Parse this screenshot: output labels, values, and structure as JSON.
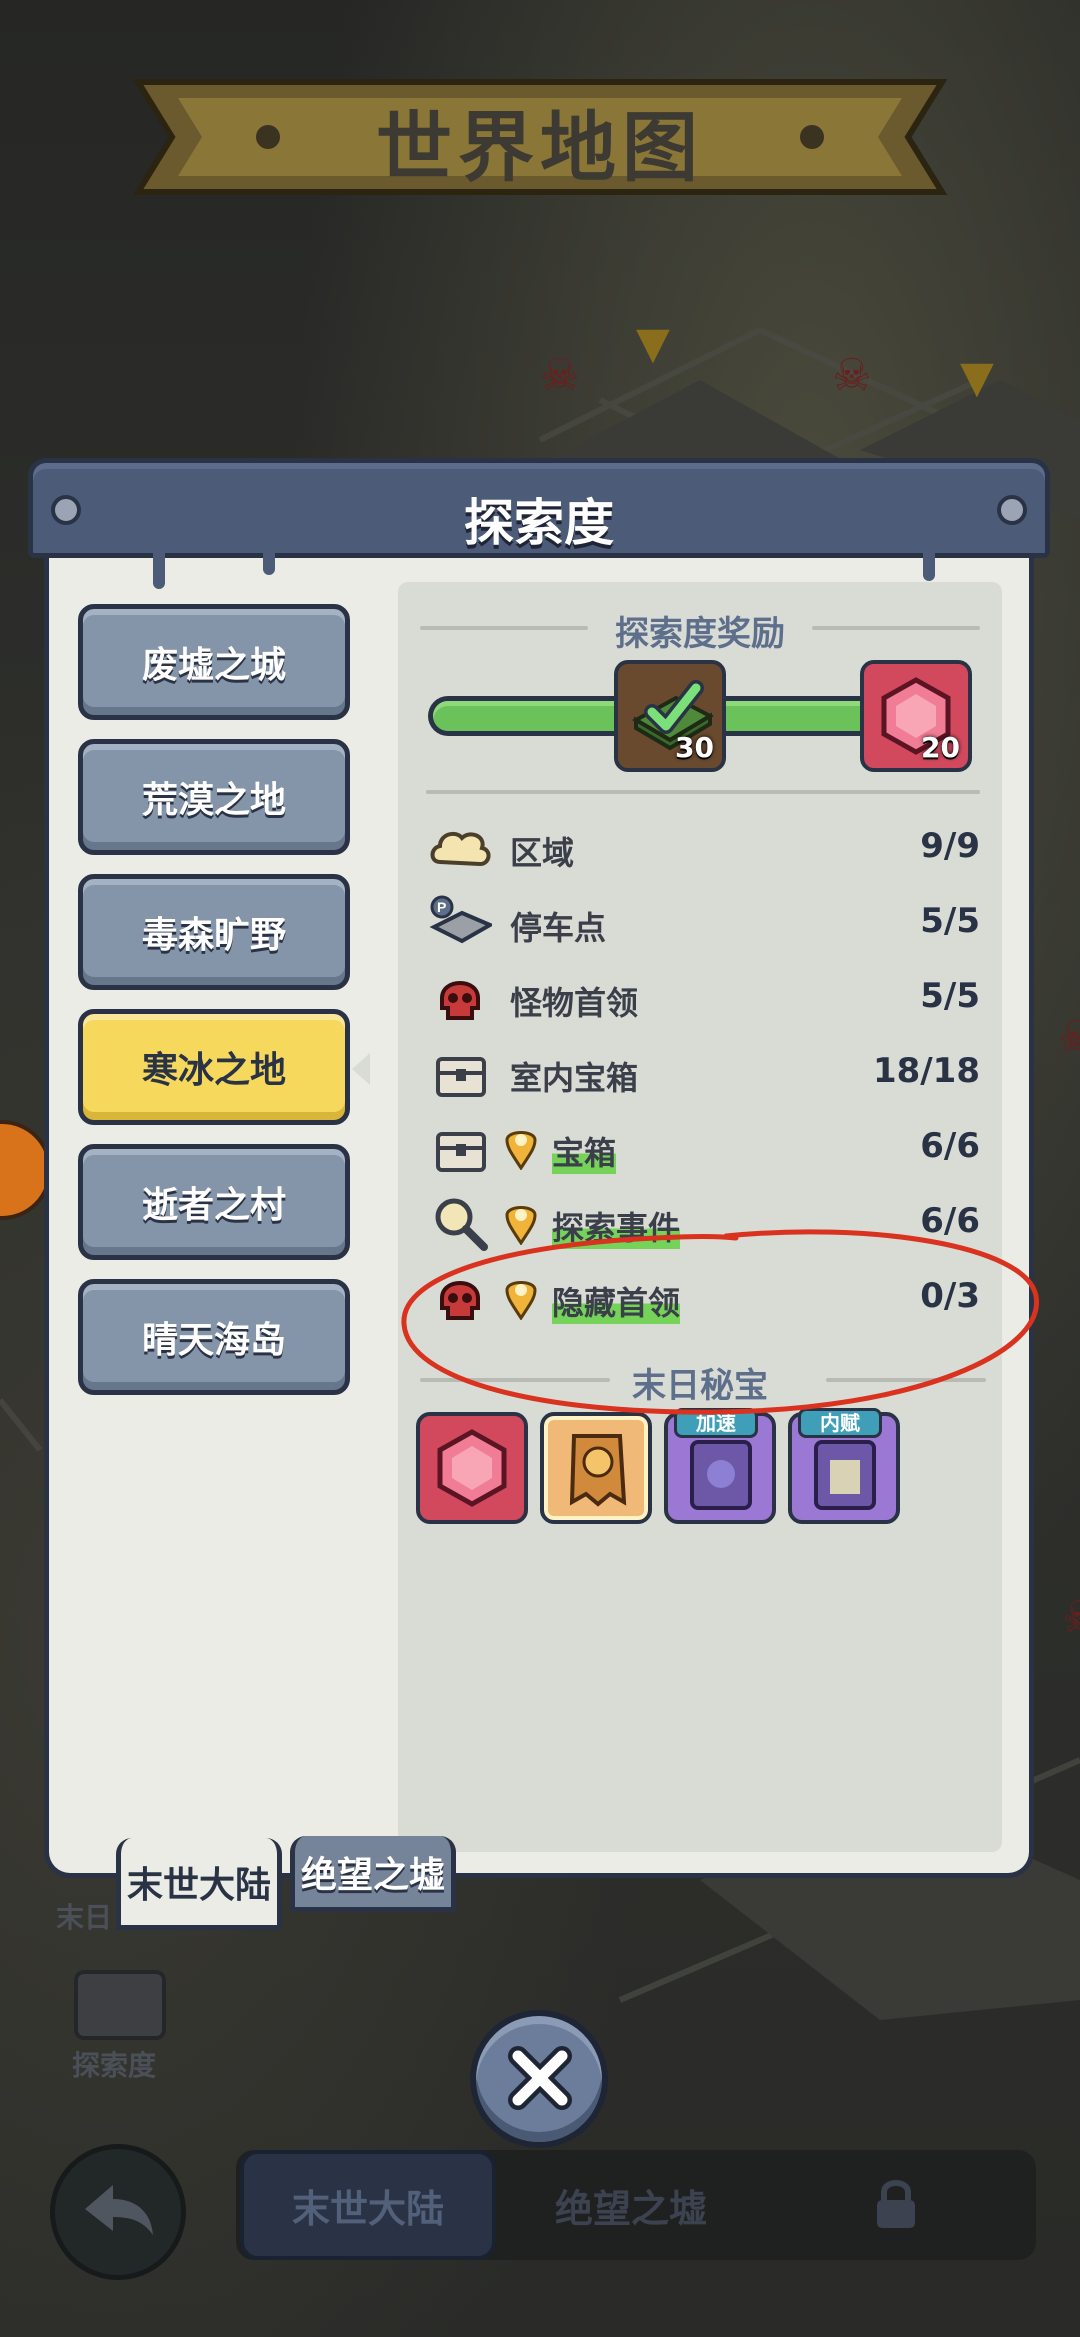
{
  "background": {
    "map_title": "世界地图",
    "labels": {
      "end_prefix": "末日",
      "exploration": "探索度"
    }
  },
  "panel": {
    "title": "探索度",
    "regions": [
      {
        "label": "废墟之城",
        "active": false
      },
      {
        "label": "荒漠之地",
        "active": false
      },
      {
        "label": "毒森旷野",
        "active": false
      },
      {
        "label": "寒冰之地",
        "active": true
      },
      {
        "label": "逝者之村",
        "active": false
      },
      {
        "label": "晴天海岛",
        "active": false
      }
    ],
    "reward_section": {
      "title": "探索度奖励",
      "progress": 1.0,
      "rewards": [
        {
          "icon": "cash-stack-icon",
          "count": "30",
          "claimed": true
        },
        {
          "icon": "red-gem-icon",
          "count": "20",
          "claimed": false
        }
      ]
    },
    "stats": [
      {
        "icon": "cloud-icon",
        "label": "区域",
        "value": "9/9",
        "highlight": false
      },
      {
        "icon": "parking-map-icon",
        "label": "停车点",
        "value": "5/5",
        "highlight": false
      },
      {
        "icon": "skull-icon",
        "label": "怪物首领",
        "value": "5/5",
        "highlight": false
      },
      {
        "icon": "chest-icon",
        "label": "室内宝箱",
        "value": "18/18",
        "highlight": false
      },
      {
        "icon": "chest-icon",
        "label": "宝箱",
        "value": "6/6",
        "highlight": true
      },
      {
        "icon": "magnifier-icon",
        "label": "探索事件",
        "value": "6/6",
        "highlight": true
      },
      {
        "icon": "skull-icon",
        "label": "隐藏首领",
        "value": "0/3",
        "highlight": true
      }
    ],
    "treasure_section": {
      "title": "末日秘宝",
      "items": [
        {
          "icon": "red-gem-icon",
          "tag": ""
        },
        {
          "icon": "scroll-ticket-icon",
          "tag": ""
        },
        {
          "icon": "speed-book-icon",
          "tag": "加速"
        },
        {
          "icon": "manual-book-icon",
          "tag": "内赋"
        }
      ]
    }
  },
  "map_tabs": [
    {
      "label": "末世大陆",
      "active": true
    },
    {
      "label": "绝望之墟",
      "active": false
    }
  ],
  "bottom_nav": {
    "items": [
      "末世大陆",
      "绝望之墟"
    ]
  },
  "colors": {
    "header": "#4c5b77",
    "active_tab": "#f6d85c",
    "inactive_tab": "#8595a9",
    "progress": "#6cc25a",
    "highlight": "#76d35a",
    "annotation": "#d9321f"
  }
}
